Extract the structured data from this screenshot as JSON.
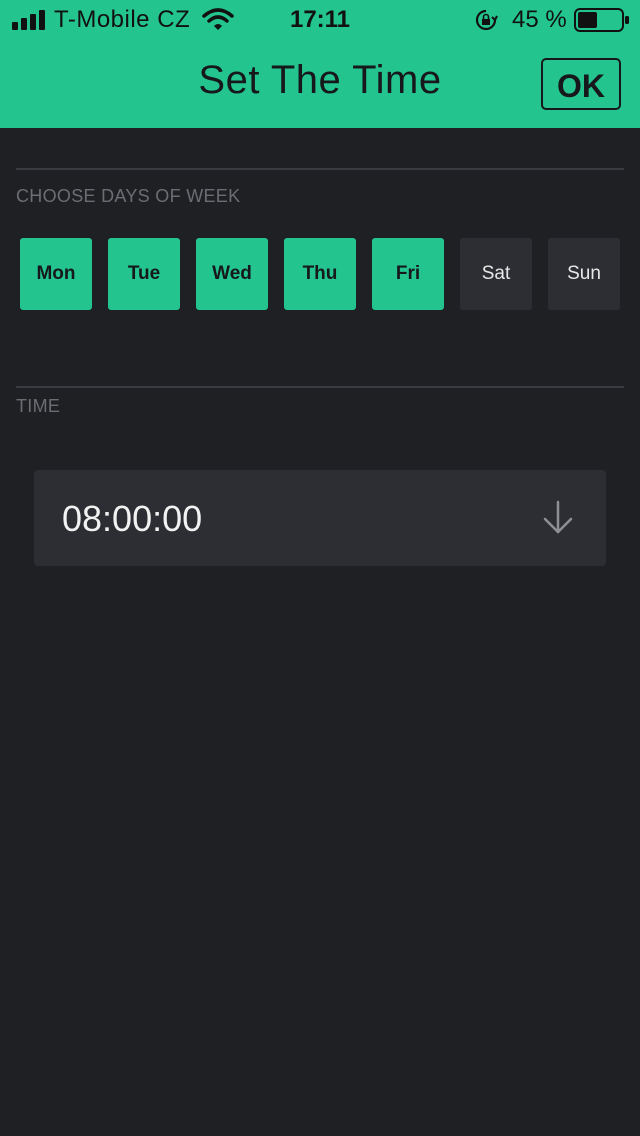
{
  "status_bar": {
    "carrier": "T-Mobile CZ",
    "time": "17:11",
    "battery_percent": "45 %",
    "battery_level": 0.45,
    "icons": [
      "signal-icon",
      "wifi-icon",
      "rotation-lock-icon",
      "battery-icon"
    ]
  },
  "header": {
    "title": "Set The Time",
    "ok_label": "OK"
  },
  "days_section": {
    "label": "CHOOSE DAYS OF WEEK",
    "days": [
      {
        "label": "Mon",
        "selected": true
      },
      {
        "label": "Tue",
        "selected": true
      },
      {
        "label": "Wed",
        "selected": true
      },
      {
        "label": "Thu",
        "selected": true
      },
      {
        "label": "Fri",
        "selected": true
      },
      {
        "label": "Sat",
        "selected": false
      },
      {
        "label": "Sun",
        "selected": false
      }
    ]
  },
  "time_section": {
    "label": "TIME",
    "value": "08:00:00",
    "icon": "arrow-down-icon"
  },
  "colors": {
    "accent": "#23c48e",
    "background": "#1f2024",
    "field": "#2d2e33"
  }
}
